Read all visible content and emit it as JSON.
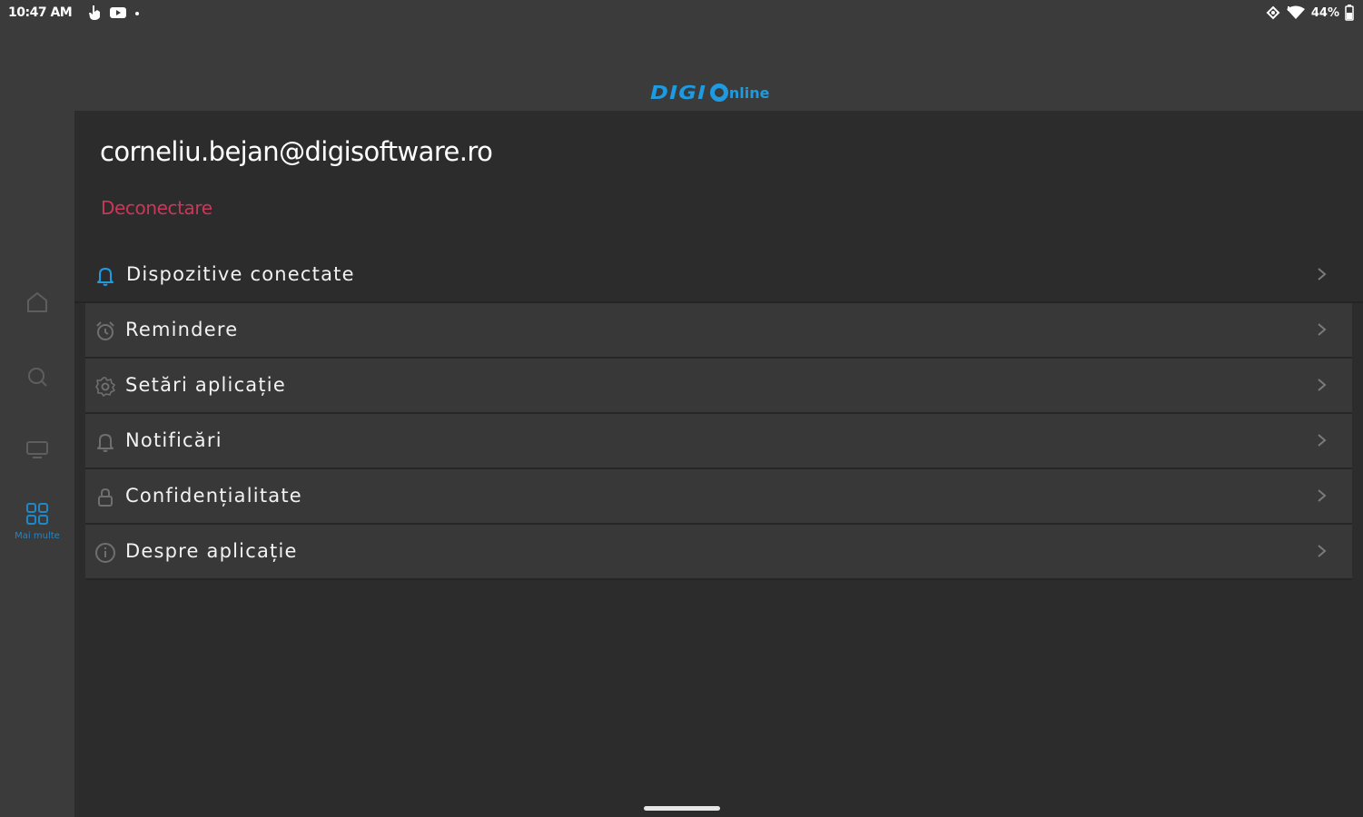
{
  "status_bar": {
    "time": "10:47 AM",
    "battery": "44%"
  },
  "header": {
    "logo_digi": "DIGI",
    "logo_online": "nline"
  },
  "rail": {
    "items": [
      {
        "name": "home",
        "icon": "home-icon"
      },
      {
        "name": "search",
        "icon": "search-icon"
      },
      {
        "name": "tv",
        "icon": "tv-icon"
      },
      {
        "name": "more",
        "icon": "grid-icon",
        "label": "Mai multe",
        "active": true
      }
    ]
  },
  "account": {
    "email": "corneliu.bejan@digisoftware.ro",
    "logout_label": "Deconectare"
  },
  "menu": {
    "items": [
      {
        "label": "Dispozitive conectate",
        "icon": "bell-icon"
      },
      {
        "label": "Remindere",
        "icon": "alarm-clock-icon"
      },
      {
        "label": "Setări aplicație",
        "icon": "gear-icon"
      },
      {
        "label": "Notificări",
        "icon": "bell-icon"
      },
      {
        "label": "Confidențialitate",
        "icon": "lock-icon"
      },
      {
        "label": "Despre aplicație",
        "icon": "info-icon"
      }
    ]
  },
  "colors": {
    "accent": "#1e9be0",
    "logout": "#c8385a",
    "background": "#2c2c2c"
  }
}
